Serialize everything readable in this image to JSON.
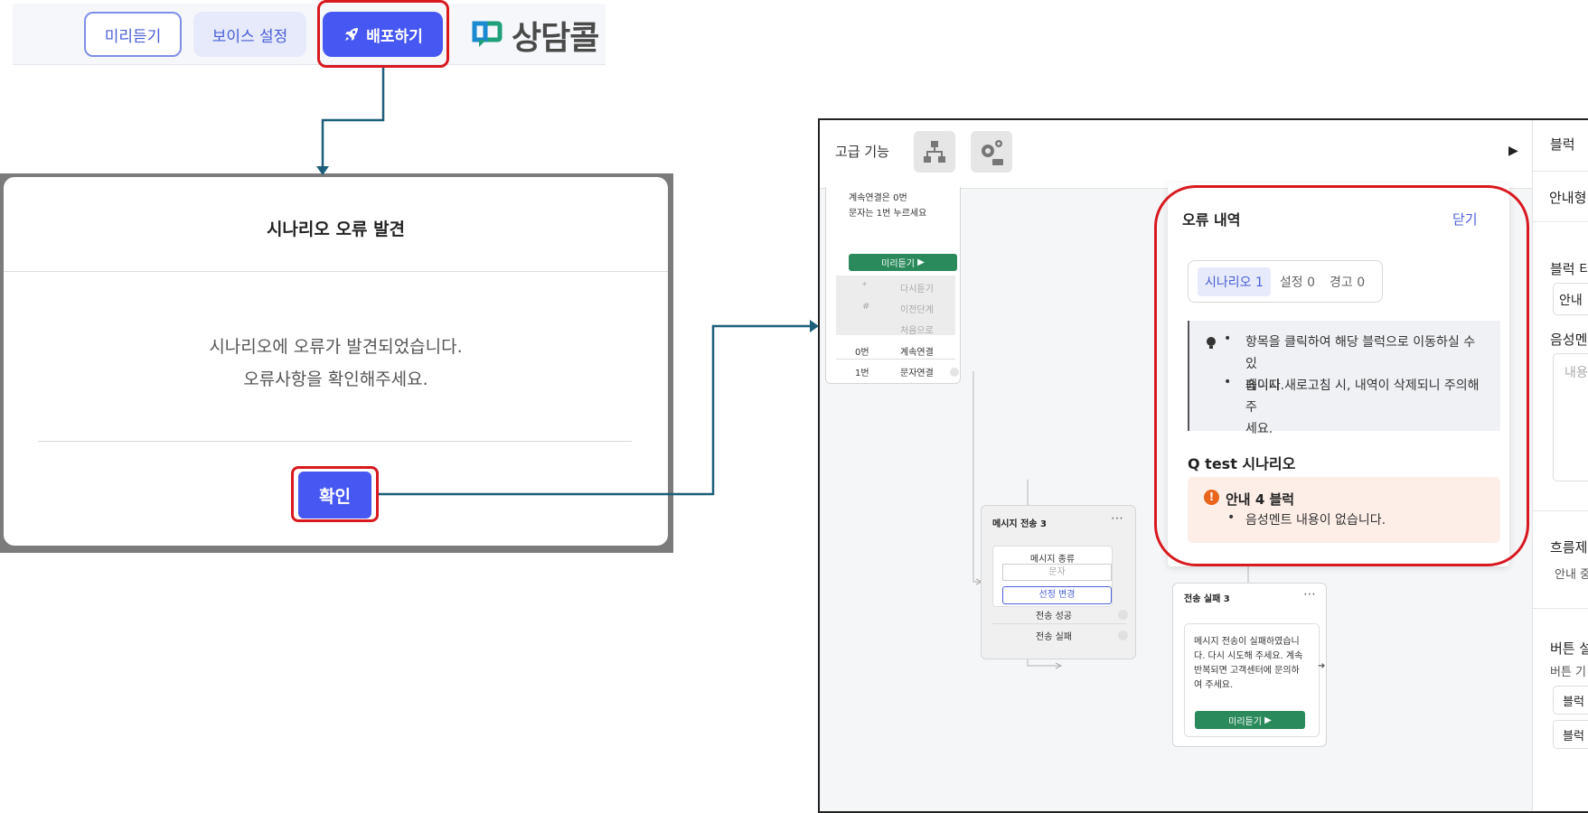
{
  "toolbar": {
    "preview_label": "미리듣기",
    "voice_label": "보이스 설정",
    "deploy_label": "배포하기",
    "logo_text": "상담콜",
    "accent_color": "#4758f2",
    "logo_icon_color": "#1fa07a"
  },
  "dialog": {
    "title": "시나리오 오류 발견",
    "message_line1": "시나리오에 오류가 발견되었습니다.",
    "message_line2": "오류사항을 확인해주세요.",
    "confirm_label": "확인"
  },
  "builder": {
    "header_label": "고급 기능",
    "icon1": "network-icon",
    "icon2": "api-gear-icon",
    "block1": {
      "line1": "계속연결은 0번",
      "line2": "문자는 1번 누르세요",
      "preview_label": "미리듣기",
      "rows": [
        {
          "key": "*",
          "value": "다시듣기"
        },
        {
          "key": "#",
          "value": "이전단계"
        },
        {
          "key": "",
          "value": "처음으로"
        },
        {
          "key": "0번",
          "value": "계속연결"
        },
        {
          "key": "1번",
          "value": "문자연결"
        }
      ]
    },
    "block2": {
      "title": "메시지 전송 3",
      "field_label": "메시지 종류",
      "field_value": "문자",
      "change_label": "선정 변경",
      "success_label": "전송 성공",
      "fail_label": "전송 실패"
    },
    "block3": {
      "title": "전송 실패 3",
      "lines": [
        "메시지 전송이 실패하였습니",
        "다. 다시 시도해 주세요. 계속",
        "반복되면 고객센터에 문의하",
        "여 주세요."
      ],
      "preview_label": "미리듣기"
    },
    "right_panel": {
      "items": [
        "블럭",
        "안내형",
        "블럭 타",
        "안내",
        "음성멘",
        "내용",
        "흐름제",
        "안내 중",
        "버튼 설",
        "버튼 기",
        "블럭",
        "블럭"
      ]
    }
  },
  "error_panel": {
    "title": "오류 내역",
    "close_label": "닫기",
    "tabs": [
      {
        "label": "시나리오 1"
      },
      {
        "label": "설정 0"
      },
      {
        "label": "경고 0"
      }
    ],
    "info_items": [
      {
        "line1": "항목을 클릭하여 해당 블럭으로 이동하실 수 있",
        "line2": "습니다."
      },
      {
        "line1": "페이지 새로고침 시, 내역이 삭제되니 주의해주",
        "line2": "세요."
      }
    ],
    "scenario_name": "Q test 시나리오",
    "error_item_title": "안내 4 블럭",
    "error_item_desc": "음성멘트 내용이 없습니다.",
    "error_color": "#e9641c"
  },
  "highlight_color": "#d8191f",
  "connector_color": "#1d5f7a"
}
